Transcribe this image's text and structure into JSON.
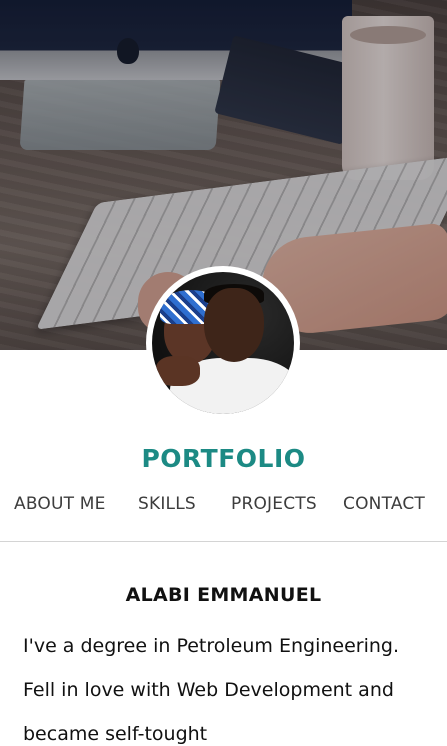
{
  "header": {
    "brand": "PORTFOLIO"
  },
  "nav": {
    "items": [
      {
        "label": "ABOUT ME"
      },
      {
        "label": "SKILLS"
      },
      {
        "label": "PROJECTS"
      },
      {
        "label": "CONTACT"
      }
    ]
  },
  "profile": {
    "name": "ALABI EMMANUEL",
    "bio": "I've a degree in Petroleum Engineering. Fell in love with Web Development and became self-tought"
  },
  "colors": {
    "brand_accent": "#1c8a84",
    "nav_text": "#3d3d3d",
    "body_text": "#111111",
    "divider": "#d4d4d4"
  }
}
